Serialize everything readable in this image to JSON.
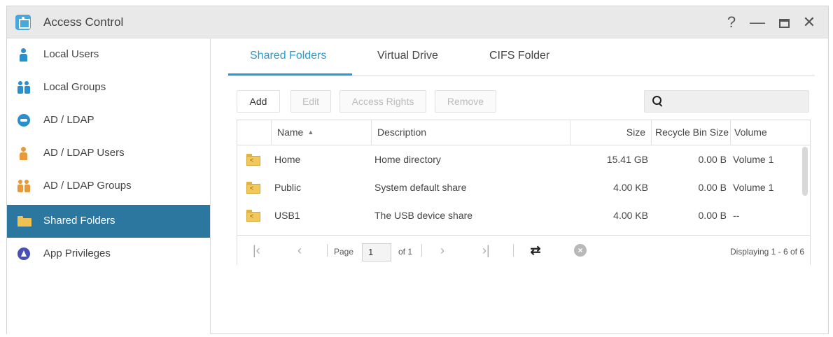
{
  "window": {
    "title": "Access Control",
    "controls": {
      "help": "?",
      "minimize": "—",
      "close": "✕"
    }
  },
  "sidebar": {
    "items": [
      {
        "label": "Local Users",
        "icon": "user-icon",
        "color": "#2a8fcf",
        "active": false
      },
      {
        "label": "Local Groups",
        "icon": "group-icon",
        "color": "#2a8fcf",
        "active": false
      },
      {
        "label": "AD / LDAP",
        "icon": "ldap-key-icon",
        "color": "#2a8fcf",
        "active": false
      },
      {
        "label": "AD / LDAP Users",
        "icon": "ldap-user-icon",
        "color": "#e69a3c",
        "active": false
      },
      {
        "label": "AD / LDAP Groups",
        "icon": "ldap-group-icon",
        "color": "#e69a3c",
        "active": false
      },
      {
        "label": "Shared Folders",
        "icon": "folder-icon",
        "color": "#f0c050",
        "active": true
      },
      {
        "label": "App Privileges",
        "icon": "app-privileges-icon",
        "color": "#4a4fb5",
        "active": false
      }
    ]
  },
  "tabs": [
    {
      "label": "Shared Folders",
      "active": true
    },
    {
      "label": "Virtual Drive",
      "active": false
    },
    {
      "label": "CIFS Folder",
      "active": false
    }
  ],
  "toolbar": {
    "add_label": "Add",
    "edit_label": "Edit",
    "access_rights_label": "Access Rights",
    "remove_label": "Remove",
    "search_placeholder": ""
  },
  "grid": {
    "columns": {
      "name": "Name",
      "description": "Description",
      "size": "Size",
      "recycle_bin_size": "Recycle Bin Size",
      "volume": "Volume"
    },
    "rows": [
      {
        "name": "Home",
        "description": "Home directory",
        "size": "15.41 GB",
        "recycle_bin_size": "0.00 B",
        "volume": "Volume 1"
      },
      {
        "name": "Public",
        "description": "System default share",
        "size": "4.00 KB",
        "recycle_bin_size": "0.00 B",
        "volume": "Volume 1"
      },
      {
        "name": "USB1",
        "description": "The USB device share",
        "size": "4.00 KB",
        "recycle_bin_size": "0.00 B",
        "volume": "--"
      }
    ]
  },
  "pager": {
    "page_label": "Page",
    "current_page": "1",
    "of_label": "of 1",
    "display_text": "Displaying 1 - 6 of 6"
  },
  "colors": {
    "accent": "#2a9bd1",
    "sidebar_active": "#2b77a0"
  }
}
